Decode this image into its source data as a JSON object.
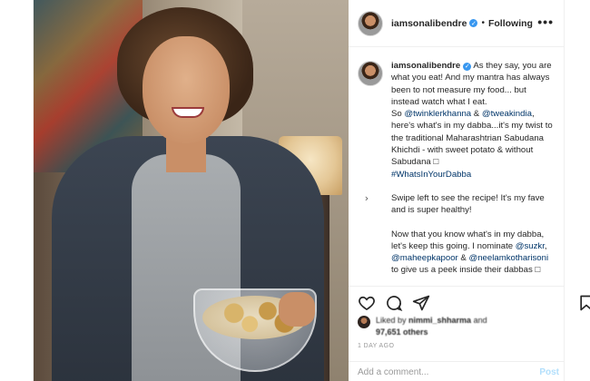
{
  "post": {
    "username": "iamsonalibendre",
    "verified_badge": "✓",
    "follow_separator": "•",
    "follow_status": "Following",
    "more_label": "•••",
    "caption": {
      "line1_rest": "As they say, you are what you eat! And my mantra has always been to not measure my food... but instead watch what I eat.",
      "p2_prefix": "So ",
      "mention1": "@twinklerkhanna",
      "p2_amp": " & ",
      "mention2": "@tweakindia",
      "p2_body": ", here's what's in my dabba...it's my twist to the traditional Maharashtrian Sabudana Khichdi - with sweet potato & without Sabudana □",
      "hashtag": "#WhatsInYourDabba",
      "p3": "Swipe left to see the recipe! It's my fave and is super healthy!",
      "p4_prefix": "Now that you know what's in my dabba, let's keep this going. I nominate ",
      "nom1": "@suzkr",
      "p4_sep1": ", ",
      "nom2": "@maheepkapoor",
      "p4_sep2": " & ",
      "nom3": "@neelamkotharisoni",
      "p4_suffix": " to give us a peek inside their dabbas □"
    },
    "likes": {
      "prefix": "Liked by ",
      "liker": "nimmi_shharma",
      "middle": " and",
      "count": "97,651 others"
    },
    "date": "1 DAY AGO",
    "comment_placeholder": "Add a comment...",
    "post_button": "Post",
    "next_arrow": "›"
  },
  "icons": {
    "like": "heart-icon",
    "comment": "comment-icon",
    "share": "share-icon",
    "save": "bookmark-icon",
    "next": "chevron-right-icon"
  },
  "colors": {
    "text": "#262626",
    "link": "#003569",
    "muted": "#999999",
    "verified": "#3897f0",
    "post_button_disabled": "#b2dffc",
    "border": "#efefef"
  }
}
